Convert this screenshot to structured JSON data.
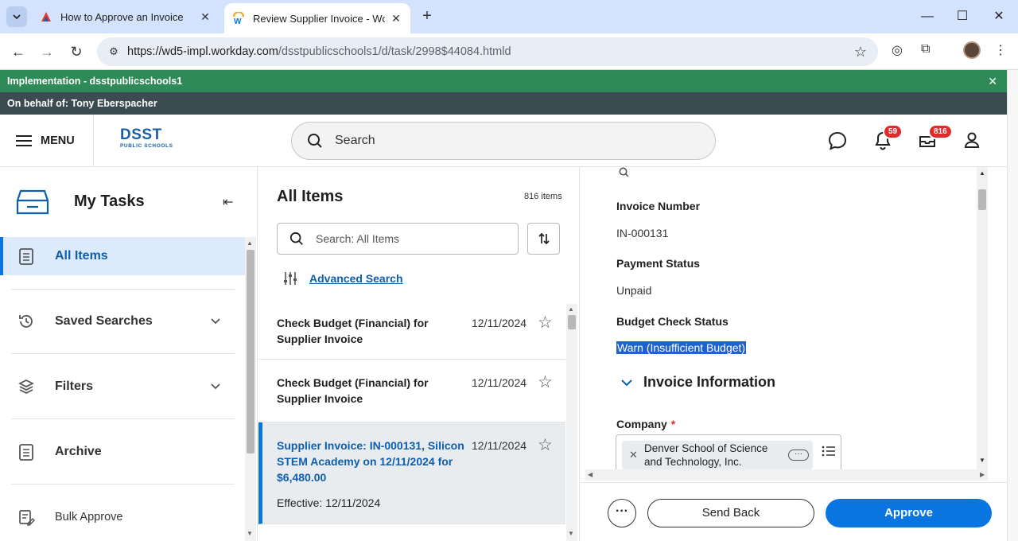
{
  "browser": {
    "tabs": [
      {
        "title": "How to Approve an Invoice",
        "active": false
      },
      {
        "title": "Review Supplier Invoice - Workday",
        "active": true
      }
    ],
    "url_main": "https://wd5-impl.workday.com",
    "url_path": "/dsstpublicschools1/d/task/2998$44084.htmld"
  },
  "banners": {
    "environment": "Implementation - dsstpublicschools1",
    "behalf": "On behalf of: Tony Eberspacher"
  },
  "header": {
    "menu_label": "MENU",
    "logo_text": "DSST",
    "logo_sub": "PUBLIC SCHOOLS",
    "search_placeholder": "Search",
    "notifications_count": "59",
    "inbox_count": "816"
  },
  "sidebar": {
    "title": "My Tasks",
    "items": [
      {
        "label": "All Items"
      },
      {
        "label": "Saved Searches"
      },
      {
        "label": "Filters"
      },
      {
        "label": "Archive"
      },
      {
        "label": "Bulk Approve"
      }
    ]
  },
  "list": {
    "title": "All Items",
    "count": "816 items",
    "search_placeholder": "Search: All Items",
    "advanced_search": "Advanced Search",
    "items": [
      {
        "title": "Check Budget (Financial) for Supplier Invoice",
        "date": "12/11/2024"
      },
      {
        "title": "Check Budget (Financial) for Supplier Invoice",
        "date": "12/11/2024"
      },
      {
        "title": "Supplier Invoice: IN-000131, Silicon STEM Academy on 12/11/2024 for $6,480.00",
        "date": "12/11/2024",
        "effective": "Effective: 12/11/2024"
      }
    ]
  },
  "detail": {
    "fields": [
      {
        "label": "Invoice Number",
        "value": "IN-000131"
      },
      {
        "label": "Payment Status",
        "value": "Unpaid"
      },
      {
        "label": "Budget Check Status",
        "value": "Warn (Insufficient Budget)"
      }
    ],
    "section": "Invoice Information",
    "company_label": "Company",
    "company_value": "Denver School of Science and Technology, Inc."
  },
  "actions": {
    "send_back": "Send Back",
    "approve": "Approve"
  },
  "colors": {
    "accent": "#0875e1",
    "env_banner": "#2e8b57",
    "behalf_banner": "#3c4a52",
    "badge": "#de2b2b"
  }
}
